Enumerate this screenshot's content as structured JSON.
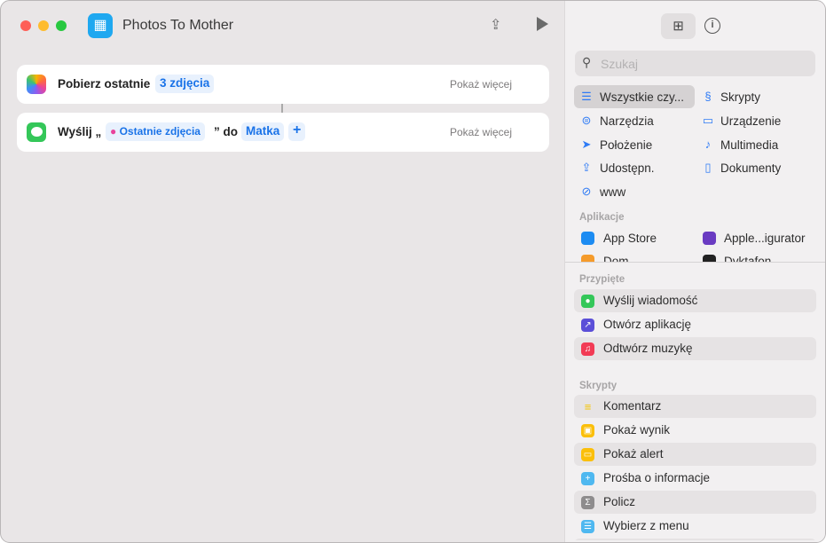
{
  "window": {
    "title": "Photos To Mother"
  },
  "actions": [
    {
      "prefix": "Pobierz ostatnie",
      "token": "3 zdjęcia",
      "more": "Pokaż więcej"
    },
    {
      "prefix": "Wyślij „",
      "token": "Ostatnie zdjęcia",
      "mid": "” do",
      "recipient": "Matka",
      "add": "+",
      "more": "Pokaż więcej"
    }
  ],
  "search": {
    "placeholder": "Szukaj"
  },
  "categories": [
    "Wszystkie czy...",
    "Skrypty",
    "Narzędzia",
    "Urządzenie",
    "Położenie",
    "Multimedia",
    "Udostępn.",
    "Dokumenty",
    "www"
  ],
  "apps": {
    "header": "Aplikacje",
    "items": [
      "App Store",
      "Apple...igurator",
      "Dom",
      "Dyktafon"
    ]
  },
  "pinned": {
    "header": "Przypięte",
    "items": [
      "Wyślij wiadomość",
      "Otwórz aplikację",
      "Odtwórz muzykę"
    ]
  },
  "scripts": {
    "header": "Skrypty",
    "items": [
      "Komentarz",
      "Pokaż wynik",
      "Pokaż alert",
      "Prośba o informacje",
      "Policz",
      "Wybierz z menu"
    ]
  },
  "colors": {
    "accent": "#1a73e8",
    "messages": "#34c759",
    "shortcut": "#1fa8f0"
  }
}
